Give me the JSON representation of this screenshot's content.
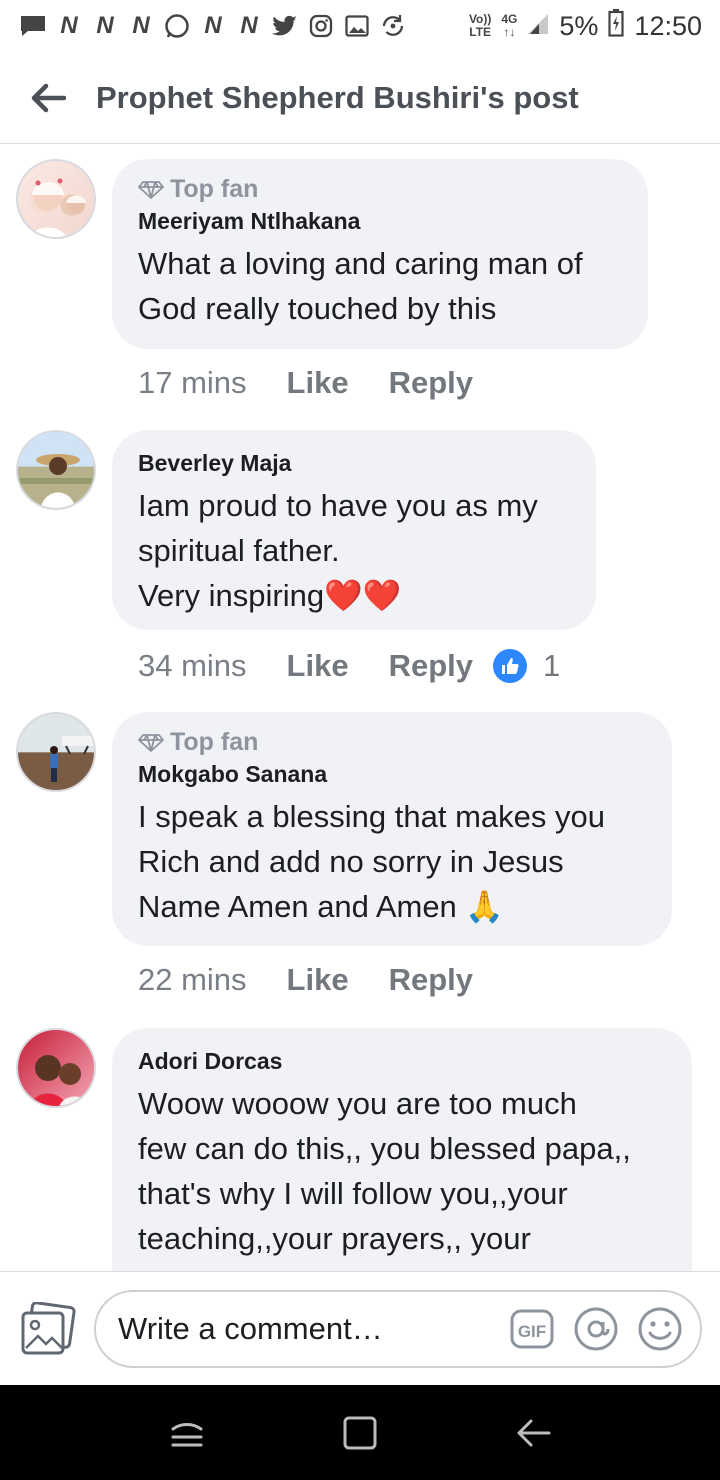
{
  "status_bar": {
    "network_top": "Vo))",
    "network_bottom": "LTE",
    "signal_top": "4G",
    "signal_bottom": "↑↓",
    "battery": "5%",
    "time": "12:50"
  },
  "header": {
    "title": "Prophet Shepherd Bushiri's post"
  },
  "comments": [
    {
      "badge": "Top fan",
      "name": "Meeriyam Ntlhakana",
      "text": "What a loving and caring man of\nGod really touched by this",
      "time": "17 mins",
      "like": "Like",
      "reply": "Reply"
    },
    {
      "name": "Beverley Maja",
      "text": "Iam proud to have you as my\nspiritual father.\nVery inspiring",
      "emoji": "❤️❤️",
      "time": "34 mins",
      "like": "Like",
      "reply": "Reply",
      "reaction_count": "1"
    },
    {
      "badge": "Top fan",
      "name": "Mokgabo Sanana",
      "text": "I speak a blessing that makes you\nRich and add no sorry in Jesus\nName Amen and Amen ",
      "emoji": "🙏",
      "time": "22 mins",
      "like": "Like",
      "reply": "Reply"
    },
    {
      "name": "Adori Dorcas",
      "text": "Woow wooow you are too much\nfew can do this,, you blessed papa,,\nthat's why I will follow you,,your\nteaching,,your prayers,, your"
    }
  ],
  "composer": {
    "placeholder": "Write a comment…",
    "gif_label": "GIF"
  },
  "colors": {
    "accent": "#2d88ff",
    "bubble": "#f0f2f5",
    "secondary_text": "#7a7f87",
    "nav_bar": "#000000"
  }
}
